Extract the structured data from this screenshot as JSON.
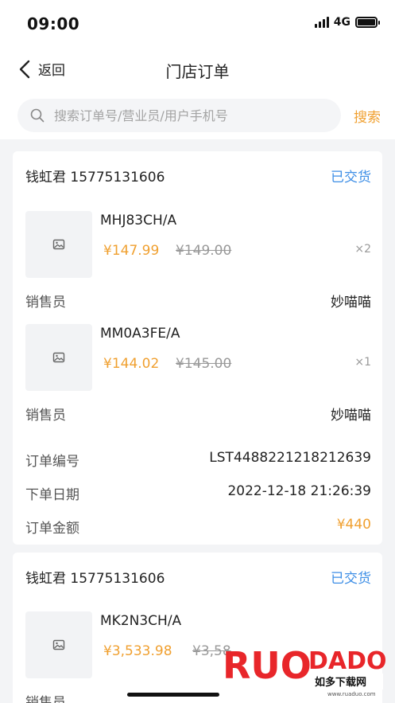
{
  "status_bar": {
    "time": "09:00",
    "network": "4G"
  },
  "nav": {
    "back_label": "返回",
    "title": "门店订单"
  },
  "search": {
    "placeholder": "搜索订单号/营业员/用户手机号",
    "button_label": "搜索"
  },
  "orders": [
    {
      "buyer": "钱虹君 15775131606",
      "status": "已交货",
      "items": [
        {
          "sku": "MHJ83CH/A",
          "price": "¥147.99",
          "original_price": "¥149.00",
          "qty": "×2",
          "seller_label": "销售员",
          "seller": "妙喵喵"
        },
        {
          "sku": "MM0A3FE/A",
          "price": "¥144.02",
          "original_price": "¥145.00",
          "qty": "×1",
          "seller_label": "销售员",
          "seller": "妙喵喵"
        }
      ],
      "order_no_label": "订单编号",
      "order_no": "LST4488221218212639",
      "order_date_label": "下单日期",
      "order_date": "2022-12-18 21:26:39",
      "amount_label": "订单金额",
      "amount": "¥440"
    },
    {
      "buyer": "钱虹君 15775131606",
      "status": "已交货",
      "items": [
        {
          "sku": "MK2N3CH/A",
          "price": "¥3,533.98",
          "original_price": "¥3,58",
          "qty": "",
          "seller_label": "销售员",
          "seller": ""
        }
      ]
    }
  ],
  "watermark": {
    "brand_left": "RUO",
    "brand_right": "DADO",
    "sub": "如多下载网",
    "url": "www.ruaduo.com"
  }
}
